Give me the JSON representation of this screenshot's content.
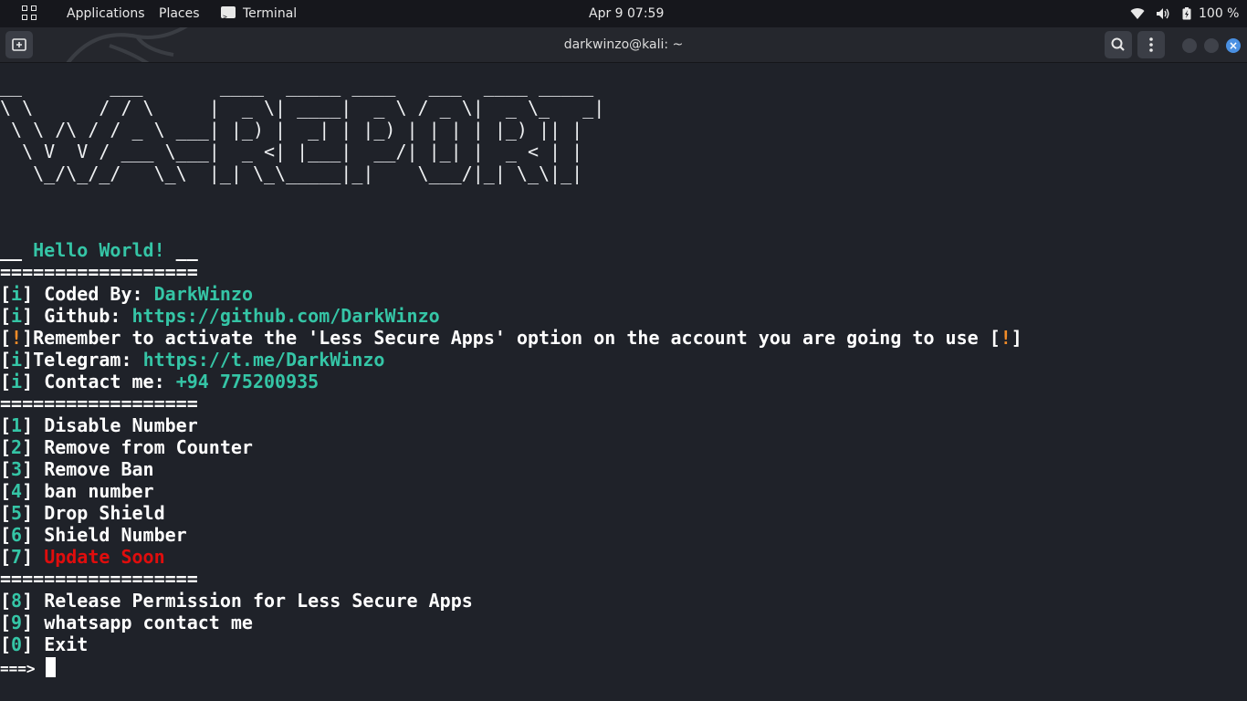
{
  "topbar": {
    "applications": "Applications",
    "places": "Places",
    "terminal": "Terminal",
    "datetime": "Apr 9  07:59",
    "battery": "100 %"
  },
  "window": {
    "title": "darkwinzo@kali: ~"
  },
  "banner_ascii": "__        ___       ____  _____ ____   ___  ____ _____\n\\ \\      / / \\     |  _ \\| ____|  _ \\ / _ \\|  _ \\_   _|\n \\ \\ /\\ / / _ \\ ___| |_) |  _| | |_) | | | | |_) || |\n  \\ V  V / ___ \\___|  _ <| |___|  __/| |_| |  _ < | |\n   \\_/\\_/_/   \\_\\  |_| \\_\\_____|_|    \\___/|_| \\_\\|_|",
  "hello": {
    "prefix": "__ ",
    "text": "Hello World!",
    "suffix": " __"
  },
  "separator": "==================",
  "info": {
    "coded_label": "Coded By: ",
    "coded_value": "DarkWinzo",
    "github_label": "Github: ",
    "github_value": "https://github.com/DarkWinzo",
    "remember": "Remember to activate the 'Less Secure Apps' option on the account you are going to use [",
    "telegram_label": "Telegram: ",
    "telegram_value": "https://t.me/DarkWinzo",
    "contact_label": "Contact me: ",
    "contact_value": "+94 775200935"
  },
  "menu": [
    {
      "key": "1",
      "label": "Disable Number"
    },
    {
      "key": "2",
      "label": "Remove from Counter"
    },
    {
      "key": "3",
      "label": "Remove Ban"
    },
    {
      "key": "4",
      "label": "ban number"
    },
    {
      "key": "5",
      "label": "Drop Shield"
    },
    {
      "key": "6",
      "label": "Shield Number"
    },
    {
      "key": "7",
      "label": "Update Soon"
    }
  ],
  "menu2": [
    {
      "key": "8",
      "label": "Release Permission for Less Secure Apps"
    },
    {
      "key": "9",
      "label": "whatsapp contact me"
    },
    {
      "key": "0",
      "label": "Exit"
    }
  ],
  "prompt": "===> "
}
